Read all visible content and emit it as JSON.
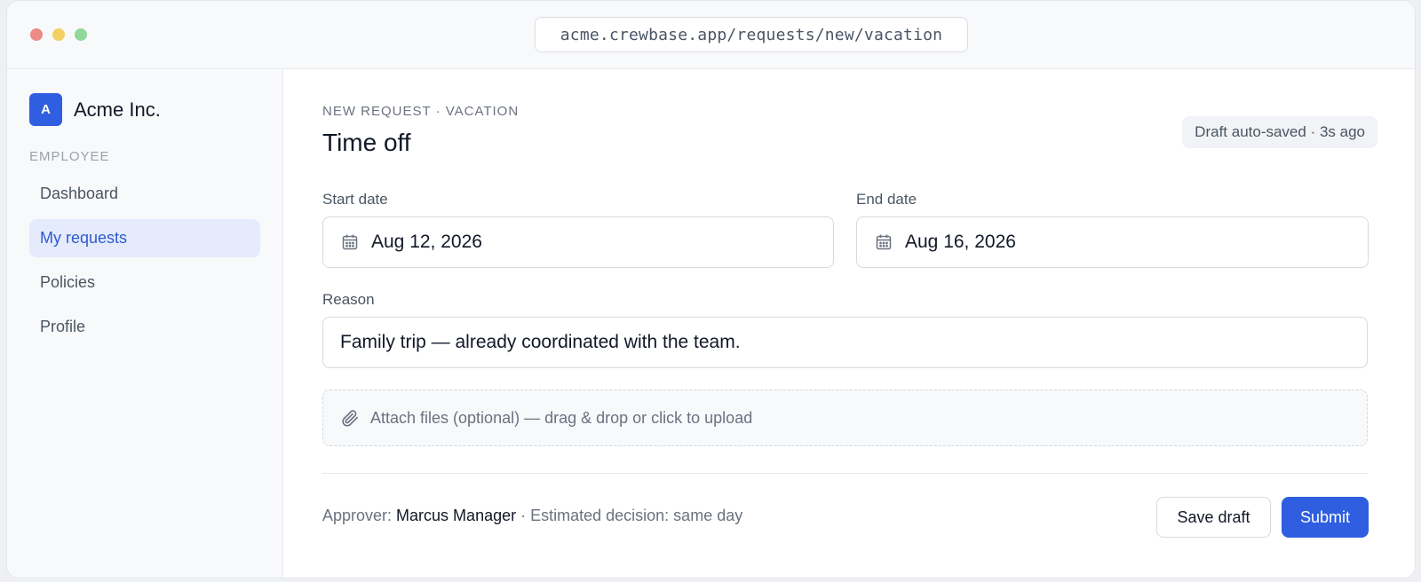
{
  "browser": {
    "url": "acme.crewbase.app/requests/new/vacation"
  },
  "sidebar": {
    "brand": {
      "logo_letter": "A",
      "name": "Acme Inc."
    },
    "section_label": "EMPLOYEE",
    "items": [
      {
        "label": "Dashboard",
        "active": false
      },
      {
        "label": "My requests",
        "active": true
      },
      {
        "label": "Policies",
        "active": false
      },
      {
        "label": "Profile",
        "active": false
      }
    ]
  },
  "main": {
    "eyebrow": "NEW REQUEST · VACATION",
    "title": "Time off",
    "draft_status": "Draft auto-saved · 3s ago",
    "start_date": {
      "label": "Start date",
      "value": "Aug 12, 2026",
      "icon": "calendar-icon"
    },
    "end_date": {
      "label": "End date",
      "value": "Aug 16, 2026",
      "icon": "calendar-icon"
    },
    "reason": {
      "label": "Reason",
      "value": "Family trip — already coordinated with the team."
    },
    "attachments": {
      "text": "Attach files (optional) — drag & drop or click to upload",
      "icon": "paperclip-icon"
    },
    "footer": {
      "approver_prefix": "Approver: ",
      "approver_name": "Marcus Manager",
      "decision_text": " · Estimated decision: same day"
    },
    "buttons": {
      "save_draft": "Save draft",
      "submit": "Submit"
    }
  },
  "colors": {
    "accent": "#2f5ee0",
    "active_nav_bg": "#e6ebfb",
    "active_nav_text": "#2f5ad0"
  }
}
